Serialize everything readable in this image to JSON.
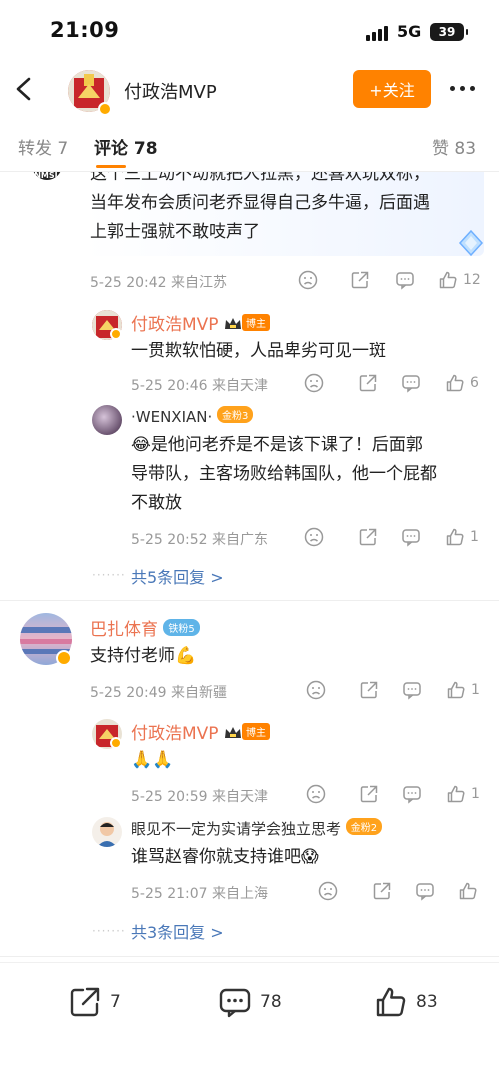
{
  "status": {
    "time": "21:09",
    "network": "5G",
    "battery": "39"
  },
  "nav": {
    "title": "付政浩MVP",
    "follow_label": "+关注"
  },
  "tabs": {
    "repost": "转发 7",
    "comment": "评论 78",
    "like": "赞 83"
  },
  "comments": [
    {
      "avatar_text": "NMSL",
      "text": "这个三土动不动就把人拉黑，还喜欢玩双标，当年发布会质问老乔显得自己多牛逼，后面遇上郭士强就不敢吱声了",
      "line1": "这个三土动不动就把人拉黑，还喜欢玩双标，",
      "line2": "当年发布会质问老乔显得自己多牛逼，后面遇",
      "line3": "上郭士强就不敢吱声了",
      "meta": "5-25 20:42  来自江苏",
      "likes": "12",
      "replies": [
        {
          "name": "付政浩MVP",
          "badge": "博主",
          "text": "一贯欺软怕硬，人品卑劣可见一斑",
          "meta": "5-25 20:46  来自天津",
          "likes": "6"
        },
        {
          "name": "·WENXIAN·",
          "badge": "金粉3",
          "line1": "是他问老乔是不是该下课了！后面郭",
          "line2": "导带队，主客场败给韩国队，他一个屁都",
          "line3": "不敢放",
          "meta": "5-25 20:52  来自广东",
          "likes": "1"
        }
      ],
      "more_replies": "共5条回复 >"
    },
    {
      "name": "巴扎体育",
      "badge": "铁粉5",
      "text": "支持付老师",
      "meta": "5-25 20:49  来自新疆",
      "likes": "1",
      "replies": [
        {
          "name": "付政浩MVP",
          "badge": "博主",
          "text": "🙏🙏",
          "meta": "5-25 20:59  来自天津",
          "likes": "1"
        },
        {
          "name": "眼见不一定为实请学会独立思考",
          "badge": "金粉2",
          "text": "谁骂赵睿你就支持谁吧",
          "meta": "5-25 21:07  来自上海",
          "likes": ""
        }
      ],
      "more_replies": "共3条回复 >"
    }
  ],
  "bottom": {
    "repost": "7",
    "comment": "78",
    "like": "83"
  },
  "colors": {
    "accent": "#ff8200",
    "name": "#eb7350",
    "link": "#4a78b8"
  }
}
